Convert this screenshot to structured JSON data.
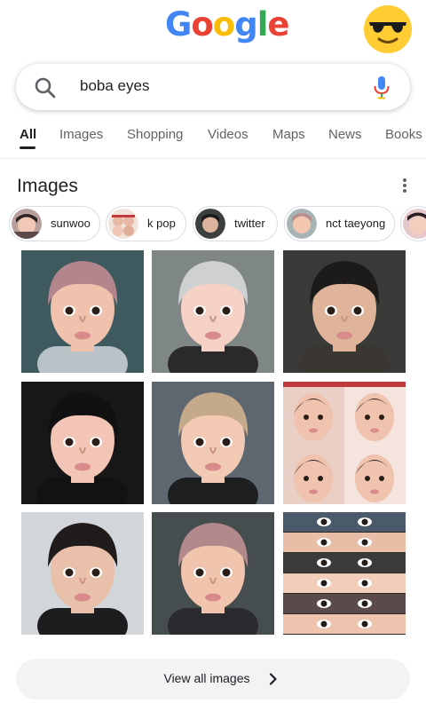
{
  "logo": {
    "letters": [
      "G",
      "o",
      "o",
      "g",
      "l",
      "e"
    ]
  },
  "header": {
    "avatar_icon": "sunglasses-emoji-icon"
  },
  "search": {
    "query": "boba eyes",
    "search_icon": "search-icon",
    "mic_icon": "microphone-icon"
  },
  "tabs": [
    {
      "label": "All",
      "active": true
    },
    {
      "label": "Images"
    },
    {
      "label": "Shopping"
    },
    {
      "label": "Videos"
    },
    {
      "label": "Maps"
    },
    {
      "label": "News"
    },
    {
      "label": "Books"
    }
  ],
  "images_section": {
    "title": "Images",
    "more_icon": "more-vert-icon",
    "chips": [
      {
        "label": ""
      },
      {
        "label": "sunwoo"
      },
      {
        "label": "k pop"
      },
      {
        "label": "twitter"
      },
      {
        "label": "nct taeyong"
      },
      {
        "label": ""
      }
    ],
    "results": [
      {
        "kind": "portrait",
        "bg": "#3f5a5e",
        "skin": "#f0c2ad",
        "hair": "#b3868d",
        "shirt": "#b9c3c7"
      },
      {
        "kind": "portrait",
        "bg": "#7e8786",
        "skin": "#f6d2c6",
        "hair": "#cfd0d2",
        "shirt": "#2d2a2b"
      },
      {
        "kind": "portrait",
        "bg": "#3a3a38",
        "skin": "#dfb49b",
        "hair": "#1d1a1a",
        "shirt": "#3a3632"
      },
      {
        "kind": "portrait",
        "bg": "#171717",
        "skin": "#f3c5b6",
        "hair": "#111111",
        "shirt": "#121212"
      },
      {
        "kind": "portrait",
        "bg": "#5e676f",
        "skin": "#f2c9b2",
        "hair": "#c4aa8b",
        "shirt": "#1d1e20"
      },
      {
        "kind": "collage",
        "bg": "#f3dcd2",
        "skin": "#efc3ae",
        "hair": "#2a1e1b",
        "shirt": "#bf3b3b"
      },
      {
        "kind": "portrait",
        "bg": "#d2d6da",
        "skin": "#e9c0a9",
        "hair": "#211c1c",
        "shirt": "#1d1d1f"
      },
      {
        "kind": "portrait",
        "bg": "#454d4e",
        "skin": "#f0c4ad",
        "hair": "#b38a8c",
        "shirt": "#2b2b2f"
      },
      {
        "kind": "strips",
        "bg": "#2b2a2a",
        "skin": "#e8bea7",
        "hair": "#2a2222",
        "shirt": "#4a5a6a"
      }
    ]
  },
  "view_all": {
    "label": "View all images",
    "chevron_icon": "chevron-right-icon"
  }
}
